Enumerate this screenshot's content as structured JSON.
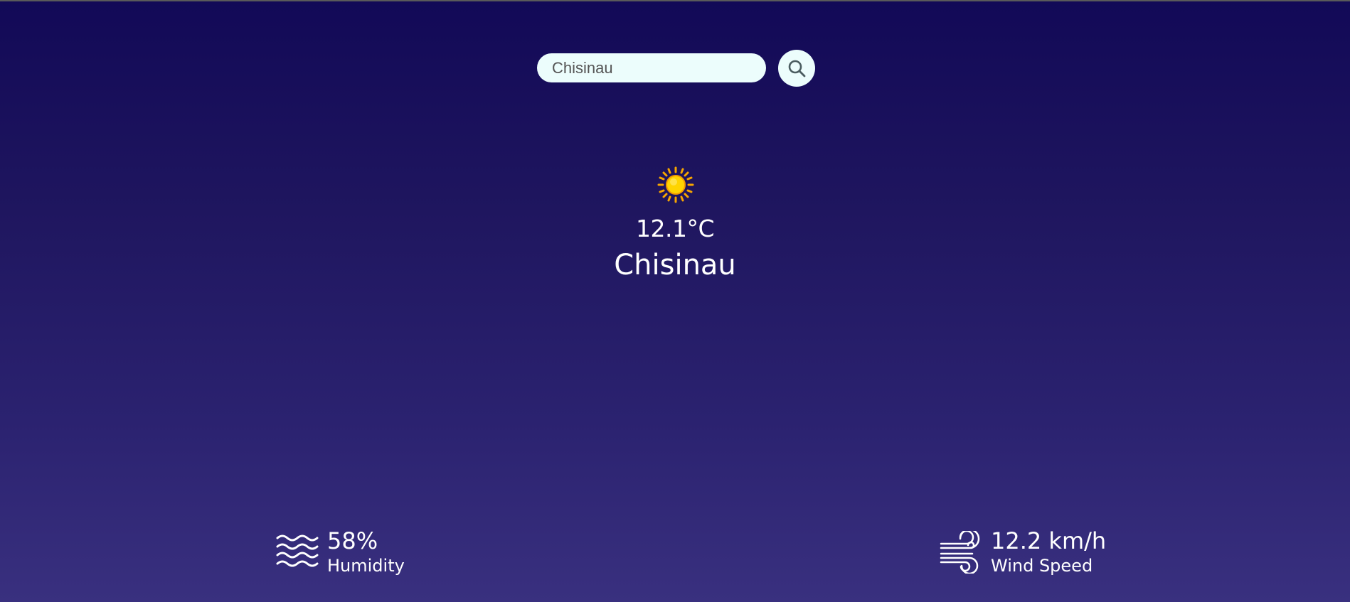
{
  "search": {
    "value": "Chisinau",
    "placeholder": ""
  },
  "search_button_icon": "search-icon",
  "weather": {
    "icon": "sun-icon",
    "temperature": "12.1°C",
    "city": "Chisinau"
  },
  "humidity": {
    "icon": "waves-icon",
    "value": "58%",
    "label": "Humidity"
  },
  "wind": {
    "icon": "wind-icon",
    "value": "12.2 km/h",
    "label": "Wind Speed"
  },
  "colors": {
    "background_top": "#120957",
    "background_bottom": "#39307f",
    "search_bg": "#ecfdfc",
    "sun_core": "#ffd400",
    "sun_rays": "#f6a500"
  }
}
